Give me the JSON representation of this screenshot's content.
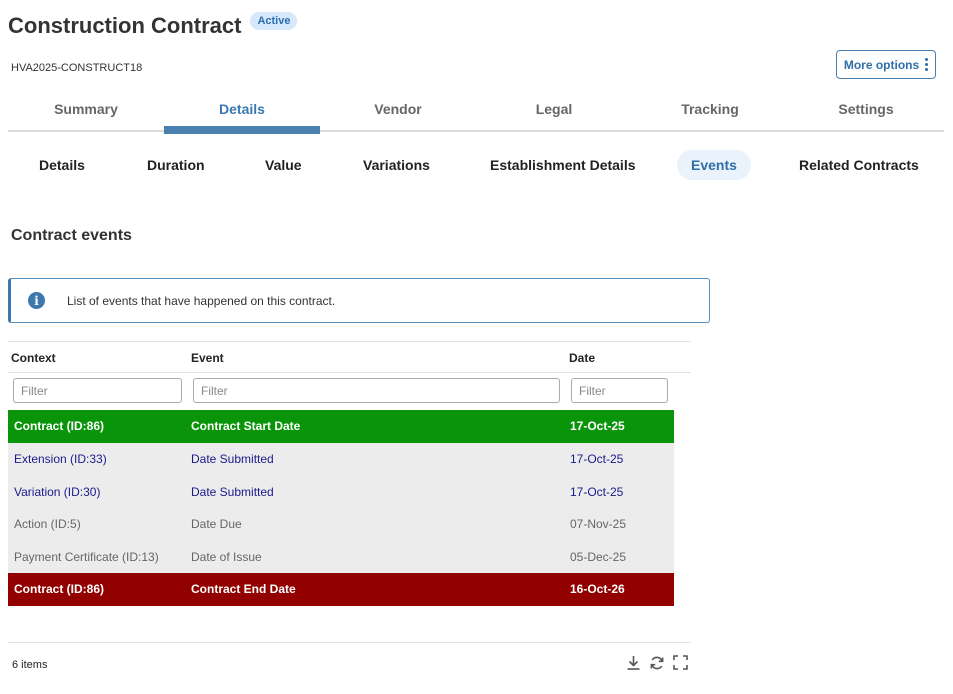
{
  "header": {
    "title": "Construction Contract",
    "status": "Active",
    "reference": "HVA2025-CONSTRUCT18",
    "more_options": "More options"
  },
  "main_tabs": [
    {
      "label": "Summary"
    },
    {
      "label": "Details",
      "active": true
    },
    {
      "label": "Vendor"
    },
    {
      "label": "Legal"
    },
    {
      "label": "Tracking"
    },
    {
      "label": "Settings"
    }
  ],
  "sub_tabs": [
    {
      "label": "Details"
    },
    {
      "label": "Duration"
    },
    {
      "label": "Value"
    },
    {
      "label": "Variations"
    },
    {
      "label": "Establishment Details"
    },
    {
      "label": "Events",
      "active": true
    },
    {
      "label": "Related Contracts"
    }
  ],
  "section": {
    "title": "Contract events",
    "info": "List of events that have happened on this contract."
  },
  "table": {
    "columns": [
      "Context",
      "Event",
      "Date"
    ],
    "filter_placeholder": "Filter",
    "rows": [
      {
        "context": "Contract (ID:86)",
        "event": "Contract Start Date",
        "date": "17-Oct-25",
        "style": "green"
      },
      {
        "context": "Extension (ID:33)",
        "event": "Date Submitted",
        "date": "17-Oct-25",
        "style": "blue"
      },
      {
        "context": "Variation (ID:30)",
        "event": "Date Submitted",
        "date": "17-Oct-25",
        "style": "blue"
      },
      {
        "context": "Action (ID:5)",
        "event": "Date Due",
        "date": "07-Nov-25",
        "style": "grey"
      },
      {
        "context": "Payment Certificate (ID:13)",
        "event": "Date of Issue",
        "date": "05-Dec-25",
        "style": "grey"
      },
      {
        "context": "Contract (ID:86)",
        "event": "Contract End Date",
        "date": "16-Oct-26",
        "style": "red"
      }
    ],
    "item_count": "6 items"
  },
  "colors": {
    "accent": "#3a79b0",
    "row_start": "#0a940a",
    "row_end": "#920000",
    "row_default": "#ececec"
  },
  "icons": {
    "more": "kebab-icon",
    "info": "info-icon",
    "download": "download-icon",
    "refresh": "refresh-icon",
    "fullscreen": "fullscreen-icon"
  }
}
